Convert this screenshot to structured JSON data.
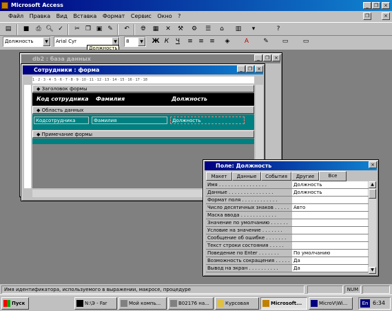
{
  "app": {
    "title": "Microsoft Access"
  },
  "menu": {
    "items": [
      "Файл",
      "Правка",
      "Вид",
      "Вставка",
      "Формат",
      "Сервис",
      "Окно",
      "?"
    ]
  },
  "formatbar": {
    "object_value": "Должность",
    "font_value": "Arial Cyr",
    "size_value": "8",
    "tooltip": "Должность"
  },
  "db_window": {
    "title": "db2 : база данных"
  },
  "form_window": {
    "title": "Сотрудники : форма"
  },
  "form": {
    "header_label": "Заголовок формы",
    "header_captions": [
      "Код сотрудника",
      "Фамилия",
      "Должность"
    ],
    "detail_label": "Область данных",
    "detail_fields": [
      "Кодсотрудника",
      "Фамилия",
      "Должность"
    ],
    "footer_label": "Примечание формы",
    "ruler": "1 · 2 · 3 · 4 · 5 · 6 · 7 · 8 · 9 · 10 · 11 · 12 · 13 · 14 · 15 · 16 · 17 · 18"
  },
  "properties": {
    "title": "Поле: Должность",
    "tabs": [
      "Макет",
      "Данные",
      "События",
      "Другие",
      "Все"
    ],
    "active_tab": "Все",
    "rows": [
      {
        "k": "Имя . . . . . . . . . . . . . . . .",
        "v": "Должность"
      },
      {
        "k": "Данные . . . . . . . . . . . . . . .",
        "v": "Должность"
      },
      {
        "k": "Формат поля . . . . . . . . . . . .",
        "v": ""
      },
      {
        "k": "Число десятичных знаков . . . . .",
        "v": "Авто"
      },
      {
        "k": "Маска ввода . . . . . . . . . . . .",
        "v": ""
      },
      {
        "k": "Значение по умолчанию . . . . . .",
        "v": ""
      },
      {
        "k": "Условие на значение . . . . . . .",
        "v": ""
      },
      {
        "k": "Сообщение об ошибке . . . . . . .",
        "v": ""
      },
      {
        "k": "Текст строки состояния . . . . .",
        "v": ""
      },
      {
        "k": "Поведение по Enter . . . . . . .",
        "v": "По умолчанию"
      },
      {
        "k": "Возможность сокращения . . . . .",
        "v": "Да"
      },
      {
        "k": "Вывод на экран . . . . . . . . . .",
        "v": "Да"
      }
    ]
  },
  "statusbar": {
    "text": "Имя идентификатора, используемого в выражении, макросе, процедуре",
    "num": "NUM"
  },
  "taskbar": {
    "start": "Пуск",
    "tasks": [
      "N:\\Э - Far",
      "Мой компь...",
      "B02176 на...",
      "Курсовая",
      "Microsoft...",
      "MicroV\\Wi..."
    ],
    "active_task": 4,
    "lang": "En",
    "time": "6:34"
  },
  "colors": {
    "teal": "#008080",
    "navy": "#000080",
    "desktop": "#008080"
  }
}
